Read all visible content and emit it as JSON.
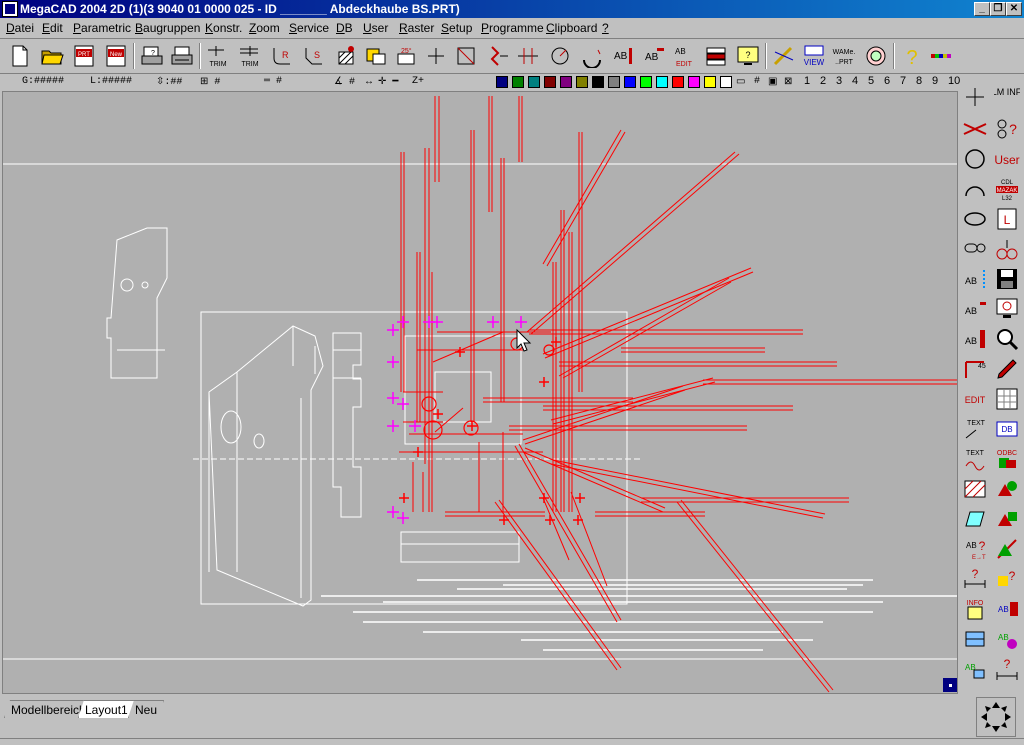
{
  "window": {
    "title": "MegaCAD 2004 2D (1)(3 9040 01 0000 025 - ID _______   Abdeckhaube BS.PRT)",
    "minimize_glyph": "_",
    "maximize_glyph": "❐",
    "close_glyph": "✕"
  },
  "menu": {
    "items": [
      {
        "u": "D",
        "rest": "atei"
      },
      {
        "u": "E",
        "rest": "dit"
      },
      {
        "u": "P",
        "rest": "arametric"
      },
      {
        "u": "B",
        "rest": "augruppen"
      },
      {
        "u": "K",
        "rest": "onstr."
      },
      {
        "u": "Z",
        "rest": "oom"
      },
      {
        "u": "S",
        "rest": "ervice"
      },
      {
        "u": "D",
        "rest": "B"
      },
      {
        "u": "U",
        "rest": "ser"
      },
      {
        "u": "R",
        "rest": "aster"
      },
      {
        "u": "S",
        "rest": "etup"
      },
      {
        "u": "P",
        "rest": "rogramme"
      },
      {
        "u": "C",
        "rest": "lipboard"
      },
      {
        "u": "?",
        "rest": ""
      }
    ]
  },
  "toolbar": {
    "buttons": [
      "new-file-icon",
      "open-folder-icon",
      "open-prt-icon",
      "new-prt-icon",
      "print-preview-icon",
      "print-icon",
      "trim-icon",
      "trim-two-icon",
      "rounding-icon",
      "chamfer-icon",
      "hatch-icon",
      "group-icon",
      "mirror-icon",
      "point-icon",
      "rectangle-icon",
      "break-icon",
      "divide-icon",
      "circle-measure-icon",
      "arc-icon",
      "text-icon",
      "text-edit-icon",
      "edit-text-icon",
      "layer-icon",
      "screen-icon",
      "pen-icon",
      "view-icon",
      "wame-prt-icon",
      "layout-icon",
      "help-icon",
      "color-bar-icon"
    ],
    "labels": {
      "trim": "TRIM",
      "trim_two": "TRIM",
      "edit": "EDIT",
      "view": "VIEW",
      "wame": "WAMe.",
      "prt": "..PRT",
      "help": "?"
    }
  },
  "status": {
    "g": "G:#####",
    "l": "L:#####",
    "scale": "⇳:##",
    "grid": "⊞ #",
    "line": "═ #",
    "angle": "∡ #",
    "zero": "Z+"
  },
  "palette": [
    "#000080",
    "#008000",
    "#008080",
    "#800000",
    "#800080",
    "#808000",
    "#000000",
    "#808080",
    "#0000ff",
    "#00ff00",
    "#00ffff",
    "#ff0000",
    "#ff00ff",
    "#ffff00",
    "#ffffff"
  ],
  "layer_buttons": [
    "1",
    "2",
    "3",
    "4",
    "5",
    "6",
    "7",
    "8",
    "9",
    "10"
  ],
  "right_panel": {
    "elm_info": "ELM INFO",
    "user": "User",
    "edit": "EDIT",
    "text": "TEXT",
    "text2": "TEXT",
    "odbc": "ODBC",
    "info": "INFO",
    "cdl": "CDL",
    "mazak": "MAZAK",
    "l32": "L32",
    "l": "L"
  },
  "tabs": [
    {
      "label": "Modellbereich",
      "active": false
    },
    {
      "label": "Layout1",
      "active": true
    },
    {
      "label": "Neu",
      "active": false
    }
  ]
}
